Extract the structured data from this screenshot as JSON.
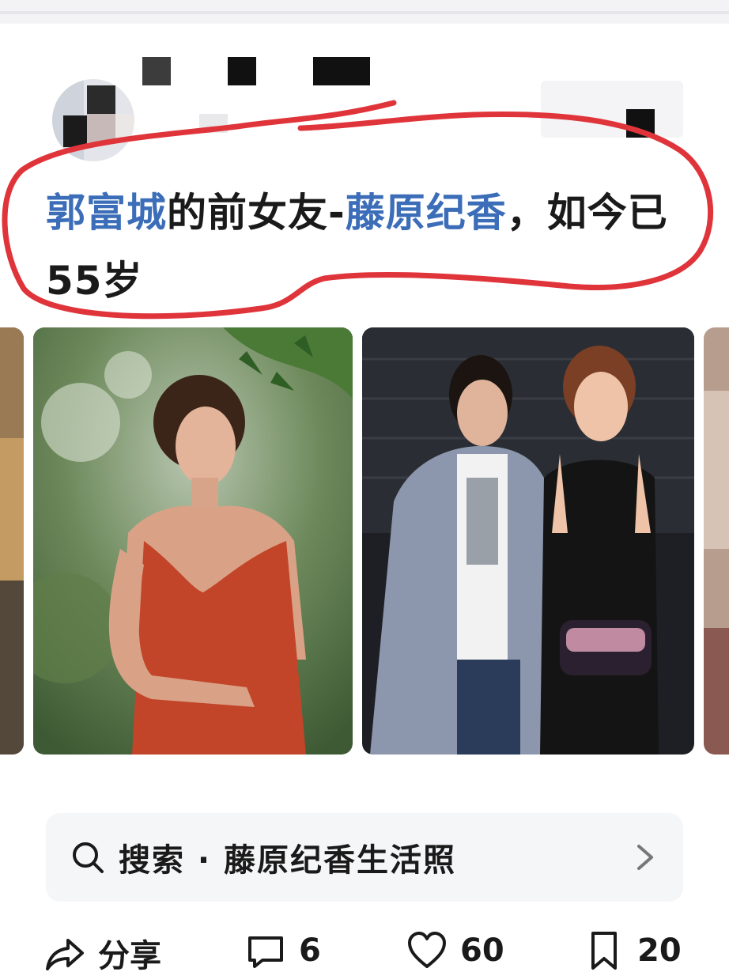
{
  "post": {
    "title_link1": "郭富城",
    "title_mid": "的前女友-",
    "title_link2": "藤原纪香",
    "title_end": "，如今已55岁"
  },
  "search": {
    "query": "搜索 · 藤原纪香生活照"
  },
  "actions": {
    "share_label": "分享",
    "comment_count": "6",
    "like_count": "60",
    "collect_count": "20"
  },
  "colors": {
    "link": "#3b6db8",
    "annotation": "#e0343b"
  },
  "icons": [
    "search-icon",
    "chevron-right-icon",
    "share-icon",
    "comment-icon",
    "heart-icon",
    "bookmark-icon"
  ]
}
